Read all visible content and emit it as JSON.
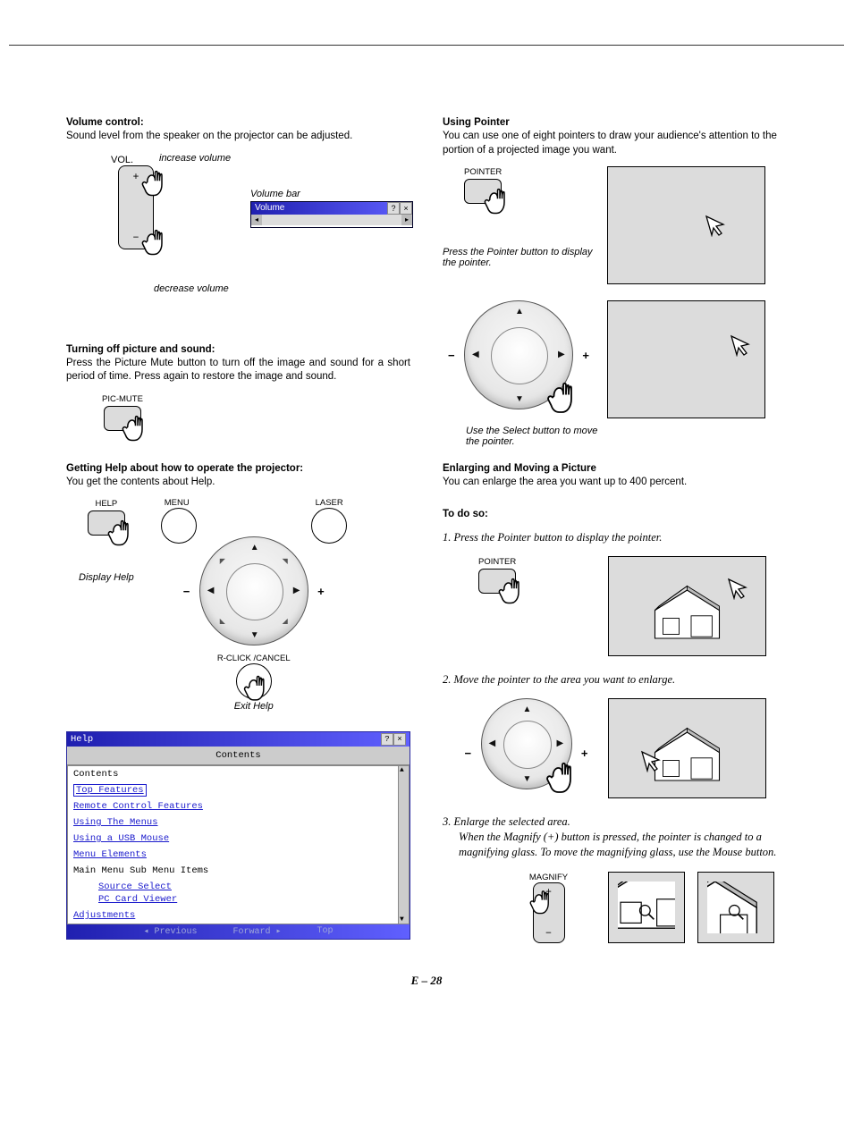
{
  "left": {
    "vol_heading": "Volume control:",
    "vol_text": "Sound level from the speaker on the projector can be adjusted.",
    "vol_label": "VOL.",
    "increase": "increase volume",
    "decrease": "decrease volume",
    "vol_bar_caption": "Volume bar",
    "vol_bar_title": "Volume",
    "mute_heading": "Turning off picture and sound:",
    "mute_text": "Press the Picture Mute button to turn off the image and sound for a short period of time. Press again to restore the image and sound.",
    "pic_mute_label": "PIC-MUTE",
    "help_heading": "Getting Help about how to operate the projector:",
    "help_text": "You get the contents about Help.",
    "help_btn_label": "HELP",
    "display_help": "Display Help",
    "menu_label": "MENU",
    "laser_label": "LASER",
    "rclick_label": "R-CLICK /CANCEL",
    "exit_help": "Exit Help",
    "help_win": {
      "title": "Help",
      "head": "Contents",
      "items": [
        {
          "text": "Contents",
          "link": false
        },
        {
          "text": "Top Features",
          "link": true,
          "boxed": true
        },
        {
          "text": "Remote Control Features",
          "link": true
        },
        {
          "text": "Using The Menus",
          "link": true
        },
        {
          "text": "Using a USB Mouse",
          "link": true
        },
        {
          "text": "Menu Elements",
          "link": true
        },
        {
          "text": "Main Menu Sub Menu Items",
          "link": false
        },
        {
          "text": "Source Select",
          "link": true,
          "sub": true
        },
        {
          "text": "PC Card Viewer",
          "link": true,
          "sub": true
        },
        {
          "text": "Adjustments",
          "link": true
        }
      ],
      "foot_prev": "◂ Previous",
      "foot_fwd": "Forward ▸",
      "foot_top": "Top"
    }
  },
  "right": {
    "pointer_heading": "Using Pointer",
    "pointer_text": "You can use one of eight pointers to draw your audience's attention to the portion of a projected image you want.",
    "pointer_btn_label": "POINTER",
    "press_pointer": "Press the Pointer button to display the pointer.",
    "use_select": "Use the Select button to move the pointer.",
    "enlarge_heading": "Enlarging and Moving a Picture",
    "enlarge_text": "You can enlarge the area you want up to 400 percent.",
    "todo": "To do so:",
    "step1": "Press the Pointer button to display the pointer.",
    "step2": "Move the pointer to the area you want to enlarge.",
    "step3": "Enlarge the selected area.",
    "step3_note": "When the Magnify (+) button is pressed, the pointer is changed to a magnifying glass. To move the magnifying glass, use the Mouse button.",
    "magnify_label": "MAGNIFY"
  },
  "page_number": "E – 28"
}
